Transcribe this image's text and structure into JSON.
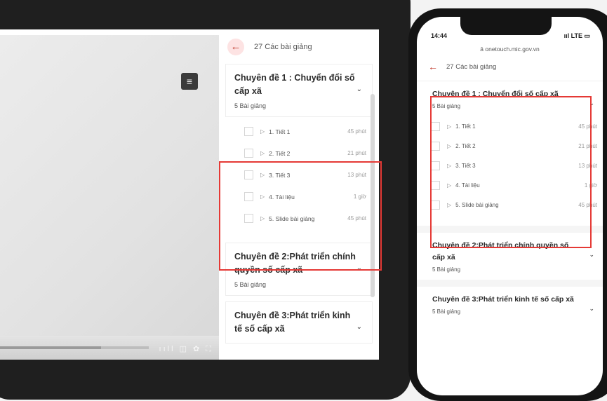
{
  "laptop": {
    "header": {
      "count_label": "27 Các bài giảng",
      "back_icon": "arrow-left-icon",
      "menu_icon": "list-icon"
    },
    "video": {
      "progress": 0.68,
      "controls": "ııll  ◫  ✿  ⛶"
    },
    "chapters": [
      {
        "title": "Chuyên đề 1 : Chuyển đổi số cấp xã",
        "sub": "5 Bài giảng",
        "lessons": [
          {
            "name": "1. Tiết 1",
            "dur": "45 phút"
          },
          {
            "name": "2. Tiết 2",
            "dur": "21 phút"
          },
          {
            "name": "3. Tiết 3",
            "dur": "13 phút"
          },
          {
            "name": "4. Tài liệu",
            "dur": "1 giờ"
          },
          {
            "name": "5. Slide bài giảng",
            "dur": "45 phút"
          }
        ]
      },
      {
        "title": "Chuyên đề 2:Phát triển chính quyền số cấp xã",
        "sub": "5 Bài giảng"
      },
      {
        "title": "Chuyên đề 3:Phát triển kinh tế số cấp xã",
        "sub": ""
      }
    ]
  },
  "phone": {
    "status": {
      "time": "14:44",
      "right": "ııl LTE ▭"
    },
    "url": "ā onetouch.mic.gov.vn",
    "header": {
      "count_label": "27 Các bài giảng"
    },
    "chapters": [
      {
        "title": "Chuyên đề 1 : Chuyển đổi số cấp xã",
        "sub": "5 Bài giảng",
        "lessons": [
          {
            "name": "1. Tiết 1",
            "dur": "45 phút"
          },
          {
            "name": "2. Tiết 2",
            "dur": "21 phút"
          },
          {
            "name": "3. Tiết 3",
            "dur": "13 phút"
          },
          {
            "name": "4. Tài liệu",
            "dur": "1 giờ"
          },
          {
            "name": "5. Slide bài giảng",
            "dur": "45 phút"
          }
        ]
      },
      {
        "title": "Chuyên đề 2:Phát triển chính quyền số cấp xã",
        "sub": "5 Bài giảng"
      },
      {
        "title": "Chuyên đề 3:Phát triển kinh tế số cấp xã",
        "sub": "5 Bài giảng"
      }
    ]
  },
  "icons": {
    "play": "▷",
    "back": "←",
    "chevron": "⌄",
    "menu": "≡"
  }
}
